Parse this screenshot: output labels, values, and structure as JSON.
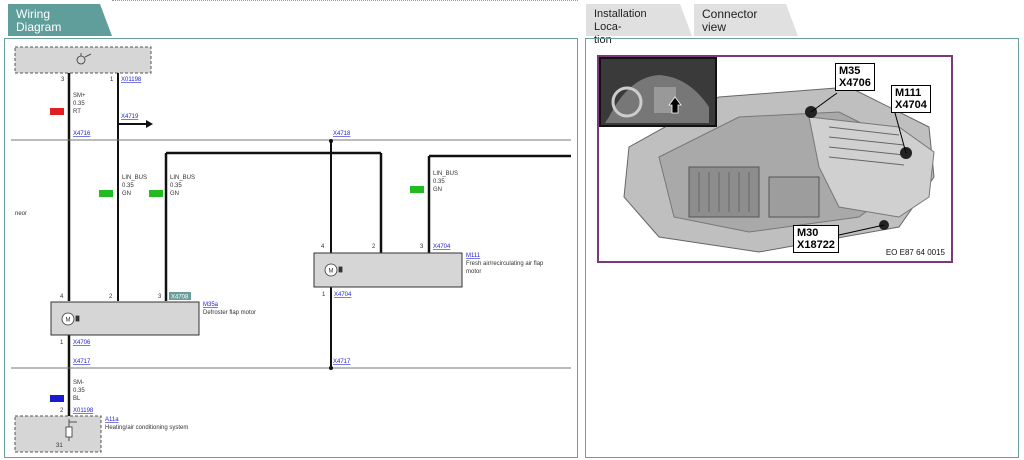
{
  "tabs": {
    "wiring": "Wiring Diagram",
    "installation": "Installation Loca-\ntion",
    "connector": "Connector view"
  },
  "diagram": {
    "top_pins": {
      "left": "3",
      "right": "1"
    },
    "top_connector": "X01198",
    "sm_plus": {
      "name": "SM+",
      "size": "0.35",
      "color": "RT"
    },
    "x4719": "X4719",
    "x4716_left": "X4716",
    "x4716_right": "X4718",
    "lin1": {
      "name": "LIN_BUS",
      "size": "0.35",
      "color": "GN"
    },
    "lin2": {
      "name": "LIN_BUS",
      "size": "0.35",
      "color": "GN"
    },
    "lin3": {
      "name": "LIN_BUS",
      "size": "0.35",
      "color": "GN"
    },
    "side_label": "neor",
    "m35a_pins": {
      "p4": "4",
      "p2": "2",
      "p3": "3",
      "p1": "1"
    },
    "m35a_badge": "X4708",
    "m35a_code": "M35a",
    "m35a_name": "Defroster flap motor",
    "m35a_conn": "X4706",
    "m111_pins": {
      "p4": "4",
      "p2": "2",
      "p3": "3",
      "p1": "1"
    },
    "m111_conn_top": "X4704",
    "m111_code": "M111",
    "m111_name1": "Fresh air/recirculating air flap",
    "m111_name2": "motor",
    "m111_conn_bottom": "X4704",
    "x4717_left": "X4717",
    "x4717_right": "X4717",
    "sm_minus": {
      "name": "SM-",
      "size": "0.35",
      "color": "BL"
    },
    "bottom_pin": "2",
    "bottom_connector": "X01198",
    "a11a_code": "A11a",
    "a11a_name": "Heating/air conditioning system",
    "a11a_pin": "31"
  },
  "photo": {
    "callouts": [
      {
        "l1": "M35",
        "l2": "X4706"
      },
      {
        "l1": "M111",
        "l2": "X4704"
      },
      {
        "l1": "M30",
        "l2": "X18722"
      }
    ],
    "caption": "EO E87 64 0015"
  },
  "colors": {
    "accent": "#5f9e9a",
    "red": "#e02020",
    "green": "#22bb22",
    "blue": "#1a1ad0",
    "frame": "#7a3a7a"
  }
}
